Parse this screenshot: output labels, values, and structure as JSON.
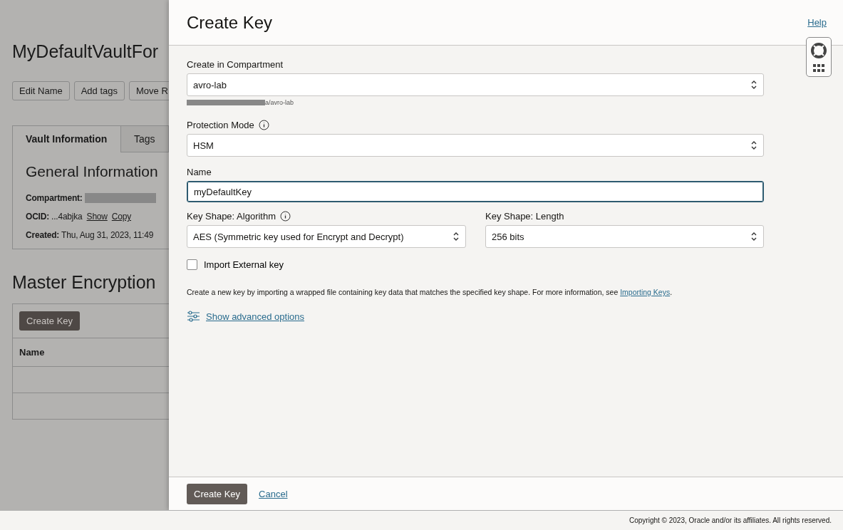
{
  "background_page": {
    "title": "MyDefaultVaultFor",
    "actions": [
      "Edit Name",
      "Add tags",
      "Move R"
    ],
    "tabs": [
      {
        "label": "Vault Information",
        "selected": true
      },
      {
        "label": "Tags",
        "selected": false
      }
    ],
    "section_title": "General Information",
    "fields": [
      {
        "label": "Compartment:",
        "kind": "redacted"
      },
      {
        "label": "OCID:",
        "value": "...4abjka",
        "links": [
          "Show",
          "Copy"
        ],
        "kind": "text"
      },
      {
        "label": "Created:",
        "value": "Thu, Aug 31, 2023, 11:49",
        "kind": "text"
      }
    ],
    "keys_title": "Master Encryption",
    "keys_button": "Create Key",
    "keys_column": "Name"
  },
  "panel": {
    "title": "Create Key",
    "help": "Help",
    "compartment": {
      "label": "Create in Compartment",
      "value": "avro-lab",
      "path": "a/avro-lab"
    },
    "protection_mode": {
      "label": "Protection Mode",
      "value": "HSM"
    },
    "name": {
      "label": "Name",
      "value": "myDefaultKey"
    },
    "algorithm": {
      "label": "Key Shape: Algorithm",
      "value": "AES (Symmetric key used for Encrypt and Decrypt)"
    },
    "length": {
      "label": "Key Shape: Length",
      "value": "256 bits"
    },
    "import_external": {
      "label": "Import External key",
      "checked": false
    },
    "description": "Create a new key by importing a wrapped file containing key data that matches the specified key shape. For more information, see ",
    "description_link": "Importing Keys",
    "description_end": ".",
    "advanced": "Show advanced options",
    "buttons": {
      "primary": "Create Key",
      "cancel": "Cancel"
    }
  },
  "footer": "Copyright © 2023, Oracle and/or its affiliates. All rights reserved."
}
